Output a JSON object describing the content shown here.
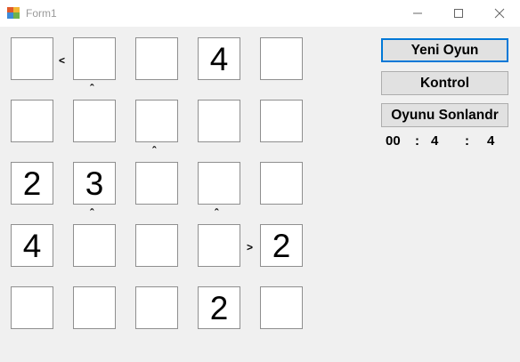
{
  "window": {
    "title": "Form1",
    "app_icon": "form-app-icon"
  },
  "controls": {
    "minimize_icon": "minimize-icon",
    "maximize_icon": "maximize-icon",
    "close_icon": "close-icon"
  },
  "grid": {
    "rows": [
      [
        "",
        "",
        "",
        "4",
        ""
      ],
      [
        "",
        "",
        "",
        "",
        ""
      ],
      [
        "2",
        "3",
        "",
        "",
        ""
      ],
      [
        "4",
        "",
        "",
        "",
        "2"
      ],
      [
        "",
        "",
        "",
        "2",
        ""
      ]
    ],
    "horizontal_signs": {
      "r0_c0": "<",
      "r3_c3": ">"
    },
    "vertical_signs": {
      "r0_c1": "ˆ",
      "r1_c2": "ˆ",
      "r2_c1": "ˆ",
      "r2_c3": "ˆ"
    }
  },
  "buttons": {
    "new_game": "Yeni Oyun",
    "check": "Kontrol",
    "finish": "Oyunu Sonlandr"
  },
  "timer": {
    "hours": "00",
    "sep1": ":",
    "minutes": "4",
    "sep2": ":",
    "seconds": "4"
  }
}
